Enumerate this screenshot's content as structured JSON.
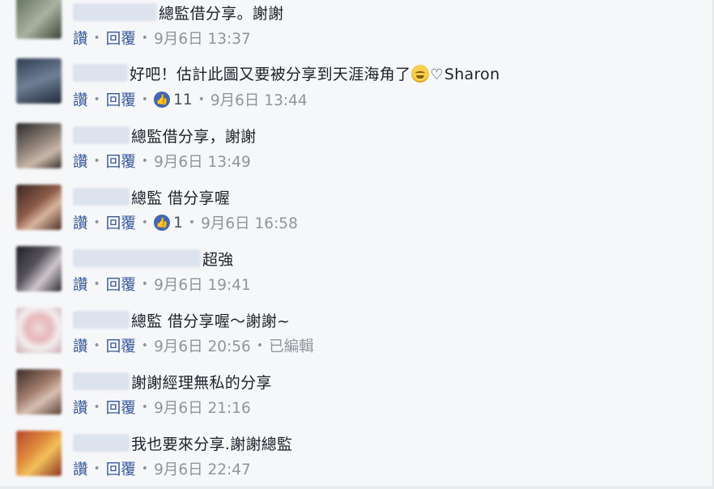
{
  "labels": {
    "like": "讚",
    "reply": "回覆",
    "edited": "已編輯"
  },
  "icons": {
    "like": "thumbs-up-icon",
    "emoji": "grinning-sweat-emoji-icon",
    "heart": "heart-icon"
  },
  "colors": {
    "link": "#365899",
    "meta": "#90949c",
    "text": "#1d2129",
    "like_badge": "#4267b2"
  },
  "comments": [
    {
      "text": "總監借分享。謝謝",
      "likes": null,
      "time": "9月6日 13:37",
      "edited": false
    },
    {
      "text": "好吧！估計此圖又要被分享到天涯海角了",
      "suffix": "Sharon",
      "likes": "11",
      "time": "9月6日 13:44",
      "edited": false
    },
    {
      "text": "總監借分享，謝謝",
      "likes": null,
      "time": "9月6日 13:49",
      "edited": false
    },
    {
      "text": "總監 借分享喔",
      "likes": "1",
      "time": "9月6日 16:58",
      "edited": false
    },
    {
      "text": "超強",
      "likes": null,
      "time": "9月6日 19:41",
      "edited": false
    },
    {
      "text": "總監 借分享喔～謝謝~",
      "likes": null,
      "time": "9月6日 20:56",
      "edited": true
    },
    {
      "text": "謝謝經理無私的分享",
      "likes": null,
      "time": "9月6日 21:16",
      "edited": false
    },
    {
      "text": "我也要來分享.謝謝總監",
      "likes": null,
      "time": "9月6日 22:47",
      "edited": false
    }
  ]
}
